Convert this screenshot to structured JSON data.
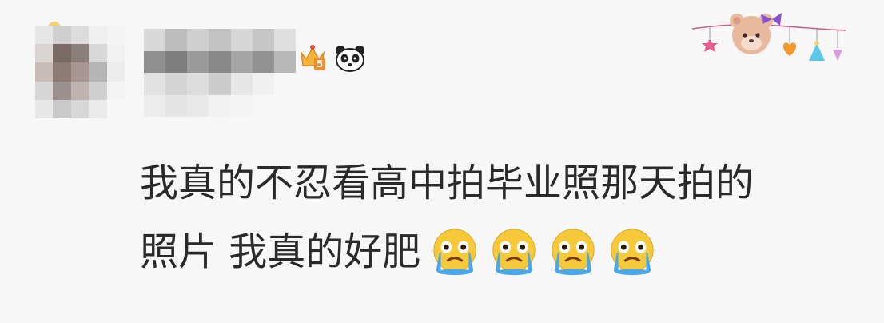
{
  "comment": {
    "line1": "我真的不忍看高中拍毕业照那天拍的",
    "line2": "照片 我真的好肥",
    "emojis": [
      "crying-face",
      "crying-face",
      "crying-face",
      "crying-face"
    ]
  },
  "badges": {
    "level": "5",
    "level_icon": "crown-level-icon",
    "fan_icon": "panda-icon"
  },
  "colors": {
    "background": "#f7f7f7",
    "text": "#2a2a2a",
    "emoji_face": "#f6c93a",
    "tears": "#4aa8e8"
  }
}
